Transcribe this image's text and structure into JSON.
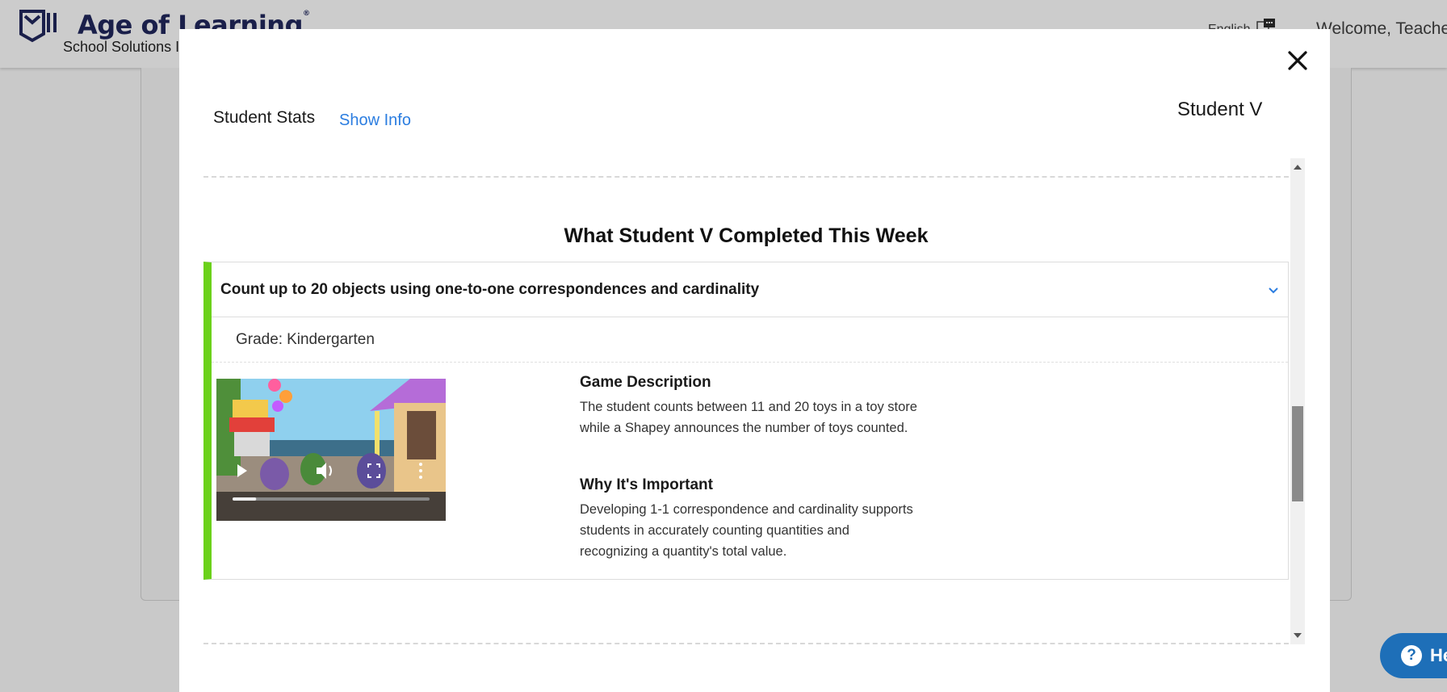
{
  "header": {
    "logo_text": "Age of Learning",
    "logo_reg": "®",
    "logo_sub": "School Solutions I",
    "language": "English",
    "welcome": "Welcome, Teacher"
  },
  "modal": {
    "tabs": {
      "stats": "Student Stats",
      "info": "Show Info"
    },
    "student_name": "Student V",
    "section_title": "What Student V Completed This Week",
    "skill": {
      "title": "Count up to 20 objects using one-to-one correspondences and cardinality",
      "grade_label": "Grade:",
      "grade_value": "Kindergarten",
      "accent_color": "#6bd11a",
      "game_description_title": "Game Description",
      "game_description": "The student counts between 11 and 20 toys in a toy store while a Shapey announces the number of toys counted.",
      "importance_title": "Why It's Important",
      "importance": "Developing 1-1 correspondence and cardinality supports students in accurately counting quantities and recognizing a quantity's total value.",
      "video_progress": 0.12
    }
  },
  "help_button": {
    "label": "He"
  },
  "colors": {
    "link": "#2b7de0",
    "help": "#1e6fb8",
    "brand": "#1a1f4a"
  }
}
